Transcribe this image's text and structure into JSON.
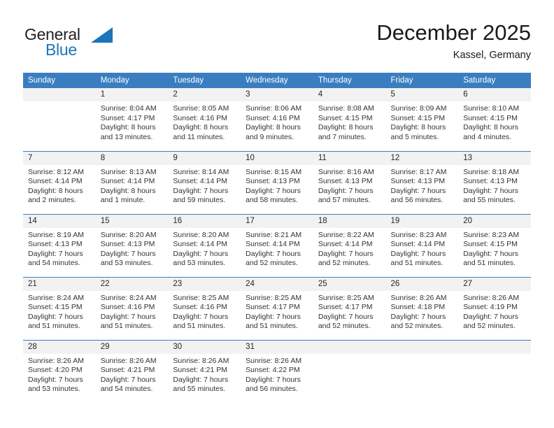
{
  "brand": {
    "name_part1": "General",
    "name_part2": "Blue",
    "triangle_color": "#1b75bb"
  },
  "header": {
    "month_title": "December 2025",
    "location": "Kassel, Germany"
  },
  "theme": {
    "header_bg": "#3a7ec1",
    "header_text": "#ffffff",
    "daynum_bg": "#f2f2f2",
    "body_text": "#333333"
  },
  "weekday_headers": [
    "Sunday",
    "Monday",
    "Tuesday",
    "Wednesday",
    "Thursday",
    "Friday",
    "Saturday"
  ],
  "weeks": [
    [
      {
        "day": "",
        "sunrise": "",
        "sunset": "",
        "daylight1": "",
        "daylight2": ""
      },
      {
        "day": "1",
        "sunrise": "Sunrise: 8:04 AM",
        "sunset": "Sunset: 4:17 PM",
        "daylight1": "Daylight: 8 hours",
        "daylight2": "and 13 minutes."
      },
      {
        "day": "2",
        "sunrise": "Sunrise: 8:05 AM",
        "sunset": "Sunset: 4:16 PM",
        "daylight1": "Daylight: 8 hours",
        "daylight2": "and 11 minutes."
      },
      {
        "day": "3",
        "sunrise": "Sunrise: 8:06 AM",
        "sunset": "Sunset: 4:16 PM",
        "daylight1": "Daylight: 8 hours",
        "daylight2": "and 9 minutes."
      },
      {
        "day": "4",
        "sunrise": "Sunrise: 8:08 AM",
        "sunset": "Sunset: 4:15 PM",
        "daylight1": "Daylight: 8 hours",
        "daylight2": "and 7 minutes."
      },
      {
        "day": "5",
        "sunrise": "Sunrise: 8:09 AM",
        "sunset": "Sunset: 4:15 PM",
        "daylight1": "Daylight: 8 hours",
        "daylight2": "and 5 minutes."
      },
      {
        "day": "6",
        "sunrise": "Sunrise: 8:10 AM",
        "sunset": "Sunset: 4:15 PM",
        "daylight1": "Daylight: 8 hours",
        "daylight2": "and 4 minutes."
      }
    ],
    [
      {
        "day": "7",
        "sunrise": "Sunrise: 8:12 AM",
        "sunset": "Sunset: 4:14 PM",
        "daylight1": "Daylight: 8 hours",
        "daylight2": "and 2 minutes."
      },
      {
        "day": "8",
        "sunrise": "Sunrise: 8:13 AM",
        "sunset": "Sunset: 4:14 PM",
        "daylight1": "Daylight: 8 hours",
        "daylight2": "and 1 minute."
      },
      {
        "day": "9",
        "sunrise": "Sunrise: 8:14 AM",
        "sunset": "Sunset: 4:14 PM",
        "daylight1": "Daylight: 7 hours",
        "daylight2": "and 59 minutes."
      },
      {
        "day": "10",
        "sunrise": "Sunrise: 8:15 AM",
        "sunset": "Sunset: 4:13 PM",
        "daylight1": "Daylight: 7 hours",
        "daylight2": "and 58 minutes."
      },
      {
        "day": "11",
        "sunrise": "Sunrise: 8:16 AM",
        "sunset": "Sunset: 4:13 PM",
        "daylight1": "Daylight: 7 hours",
        "daylight2": "and 57 minutes."
      },
      {
        "day": "12",
        "sunrise": "Sunrise: 8:17 AM",
        "sunset": "Sunset: 4:13 PM",
        "daylight1": "Daylight: 7 hours",
        "daylight2": "and 56 minutes."
      },
      {
        "day": "13",
        "sunrise": "Sunrise: 8:18 AM",
        "sunset": "Sunset: 4:13 PM",
        "daylight1": "Daylight: 7 hours",
        "daylight2": "and 55 minutes."
      }
    ],
    [
      {
        "day": "14",
        "sunrise": "Sunrise: 8:19 AM",
        "sunset": "Sunset: 4:13 PM",
        "daylight1": "Daylight: 7 hours",
        "daylight2": "and 54 minutes."
      },
      {
        "day": "15",
        "sunrise": "Sunrise: 8:20 AM",
        "sunset": "Sunset: 4:13 PM",
        "daylight1": "Daylight: 7 hours",
        "daylight2": "and 53 minutes."
      },
      {
        "day": "16",
        "sunrise": "Sunrise: 8:20 AM",
        "sunset": "Sunset: 4:14 PM",
        "daylight1": "Daylight: 7 hours",
        "daylight2": "and 53 minutes."
      },
      {
        "day": "17",
        "sunrise": "Sunrise: 8:21 AM",
        "sunset": "Sunset: 4:14 PM",
        "daylight1": "Daylight: 7 hours",
        "daylight2": "and 52 minutes."
      },
      {
        "day": "18",
        "sunrise": "Sunrise: 8:22 AM",
        "sunset": "Sunset: 4:14 PM",
        "daylight1": "Daylight: 7 hours",
        "daylight2": "and 52 minutes."
      },
      {
        "day": "19",
        "sunrise": "Sunrise: 8:23 AM",
        "sunset": "Sunset: 4:14 PM",
        "daylight1": "Daylight: 7 hours",
        "daylight2": "and 51 minutes."
      },
      {
        "day": "20",
        "sunrise": "Sunrise: 8:23 AM",
        "sunset": "Sunset: 4:15 PM",
        "daylight1": "Daylight: 7 hours",
        "daylight2": "and 51 minutes."
      }
    ],
    [
      {
        "day": "21",
        "sunrise": "Sunrise: 8:24 AM",
        "sunset": "Sunset: 4:15 PM",
        "daylight1": "Daylight: 7 hours",
        "daylight2": "and 51 minutes."
      },
      {
        "day": "22",
        "sunrise": "Sunrise: 8:24 AM",
        "sunset": "Sunset: 4:16 PM",
        "daylight1": "Daylight: 7 hours",
        "daylight2": "and 51 minutes."
      },
      {
        "day": "23",
        "sunrise": "Sunrise: 8:25 AM",
        "sunset": "Sunset: 4:16 PM",
        "daylight1": "Daylight: 7 hours",
        "daylight2": "and 51 minutes."
      },
      {
        "day": "24",
        "sunrise": "Sunrise: 8:25 AM",
        "sunset": "Sunset: 4:17 PM",
        "daylight1": "Daylight: 7 hours",
        "daylight2": "and 51 minutes."
      },
      {
        "day": "25",
        "sunrise": "Sunrise: 8:25 AM",
        "sunset": "Sunset: 4:17 PM",
        "daylight1": "Daylight: 7 hours",
        "daylight2": "and 52 minutes."
      },
      {
        "day": "26",
        "sunrise": "Sunrise: 8:26 AM",
        "sunset": "Sunset: 4:18 PM",
        "daylight1": "Daylight: 7 hours",
        "daylight2": "and 52 minutes."
      },
      {
        "day": "27",
        "sunrise": "Sunrise: 8:26 AM",
        "sunset": "Sunset: 4:19 PM",
        "daylight1": "Daylight: 7 hours",
        "daylight2": "and 52 minutes."
      }
    ],
    [
      {
        "day": "28",
        "sunrise": "Sunrise: 8:26 AM",
        "sunset": "Sunset: 4:20 PM",
        "daylight1": "Daylight: 7 hours",
        "daylight2": "and 53 minutes."
      },
      {
        "day": "29",
        "sunrise": "Sunrise: 8:26 AM",
        "sunset": "Sunset: 4:21 PM",
        "daylight1": "Daylight: 7 hours",
        "daylight2": "and 54 minutes."
      },
      {
        "day": "30",
        "sunrise": "Sunrise: 8:26 AM",
        "sunset": "Sunset: 4:21 PM",
        "daylight1": "Daylight: 7 hours",
        "daylight2": "and 55 minutes."
      },
      {
        "day": "31",
        "sunrise": "Sunrise: 8:26 AM",
        "sunset": "Sunset: 4:22 PM",
        "daylight1": "Daylight: 7 hours",
        "daylight2": "and 56 minutes."
      },
      {
        "day": "",
        "sunrise": "",
        "sunset": "",
        "daylight1": "",
        "daylight2": ""
      },
      {
        "day": "",
        "sunrise": "",
        "sunset": "",
        "daylight1": "",
        "daylight2": ""
      },
      {
        "day": "",
        "sunrise": "",
        "sunset": "",
        "daylight1": "",
        "daylight2": ""
      }
    ]
  ]
}
